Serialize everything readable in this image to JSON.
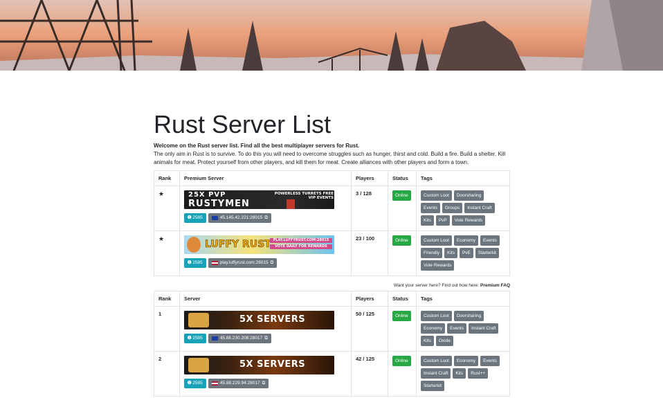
{
  "page": {
    "title": "Rust Server List",
    "intro_bold": "Welcome on the Rust server list. Find all the best multiplayer servers for Rust.",
    "intro": "The only aim in Rust is to survive. To do this you will need to overcome struggles such as hunger, thirst and cold. Build a fire. Build a shelter. Kill animals for meat. Protect yourself from other players, and kill them for meat. Create alliances with other players and form a town."
  },
  "premium_table": {
    "headers": [
      "Rank",
      "Premium Server",
      "Players",
      "Status",
      "Tags"
    ],
    "rows": [
      {
        "rank": "★",
        "banner_top": "25X PVP",
        "banner_main": "RUSTYMEN",
        "banner_side": "POWERLESS TURRETS FREE VIP EVENTS",
        "votes": "2585",
        "ip": "45.145.42.221:28015",
        "flag": "eu",
        "players": "3 / 128",
        "status": "Online",
        "tags": [
          "Custom Loot",
          "Doorsharing",
          "Events",
          "Groups",
          "Instant Craft",
          "Kits",
          "PvP",
          "Vote Rewards"
        ]
      },
      {
        "rank": "★",
        "banner_main": "LUFFY RUST",
        "banner_side": "PLAY.LUFFYRUST.COM:28015",
        "banner_side2": "VOTE DAILY FOR REWARDS",
        "votes": "2585",
        "ip": "play.luffyrust.com:28015",
        "flag": "us",
        "players": "23 / 100",
        "status": "Online",
        "tags": [
          "Custom Loot",
          "Economy",
          "Events",
          "Friendly",
          "Kits",
          "PvE",
          "Starterkit",
          "Vote Rewards"
        ]
      }
    ]
  },
  "faq": {
    "text": "Want your server here? Find out how here: ",
    "link": "Premium FAQ"
  },
  "server_table": {
    "headers": [
      "Rank",
      "Server",
      "Players",
      "Status",
      "Tags"
    ],
    "rows": [
      {
        "rank": "1",
        "banner_main": "5X SERVERS",
        "votes": "2585",
        "ip": "45.88.230.208:28017",
        "flag": "eu",
        "players": "50 / 125",
        "status": "Online",
        "tags": [
          "Custom Loot",
          "Doorsharing",
          "Economy",
          "Events",
          "Instant Craft",
          "Kits",
          "Oxide"
        ]
      },
      {
        "rank": "2",
        "banner_main": "5X SERVERS",
        "votes": "2585",
        "ip": "45.88.229.94:28017",
        "flag": "us",
        "players": "42 / 125",
        "status": "Online",
        "tags": [
          "Custom Loot",
          "Economy",
          "Events",
          "Instant Craft",
          "Kits",
          "Rust++",
          "Starterkit"
        ]
      }
    ]
  },
  "colors": {
    "vote": "#17a2b8",
    "ip": "#6c757d",
    "online": "#28a745",
    "tag": "#6c757d"
  },
  "icons": {
    "vote": "vote-arrow-icon",
    "copy": "copy-icon",
    "rank_premium": "star-icon"
  }
}
